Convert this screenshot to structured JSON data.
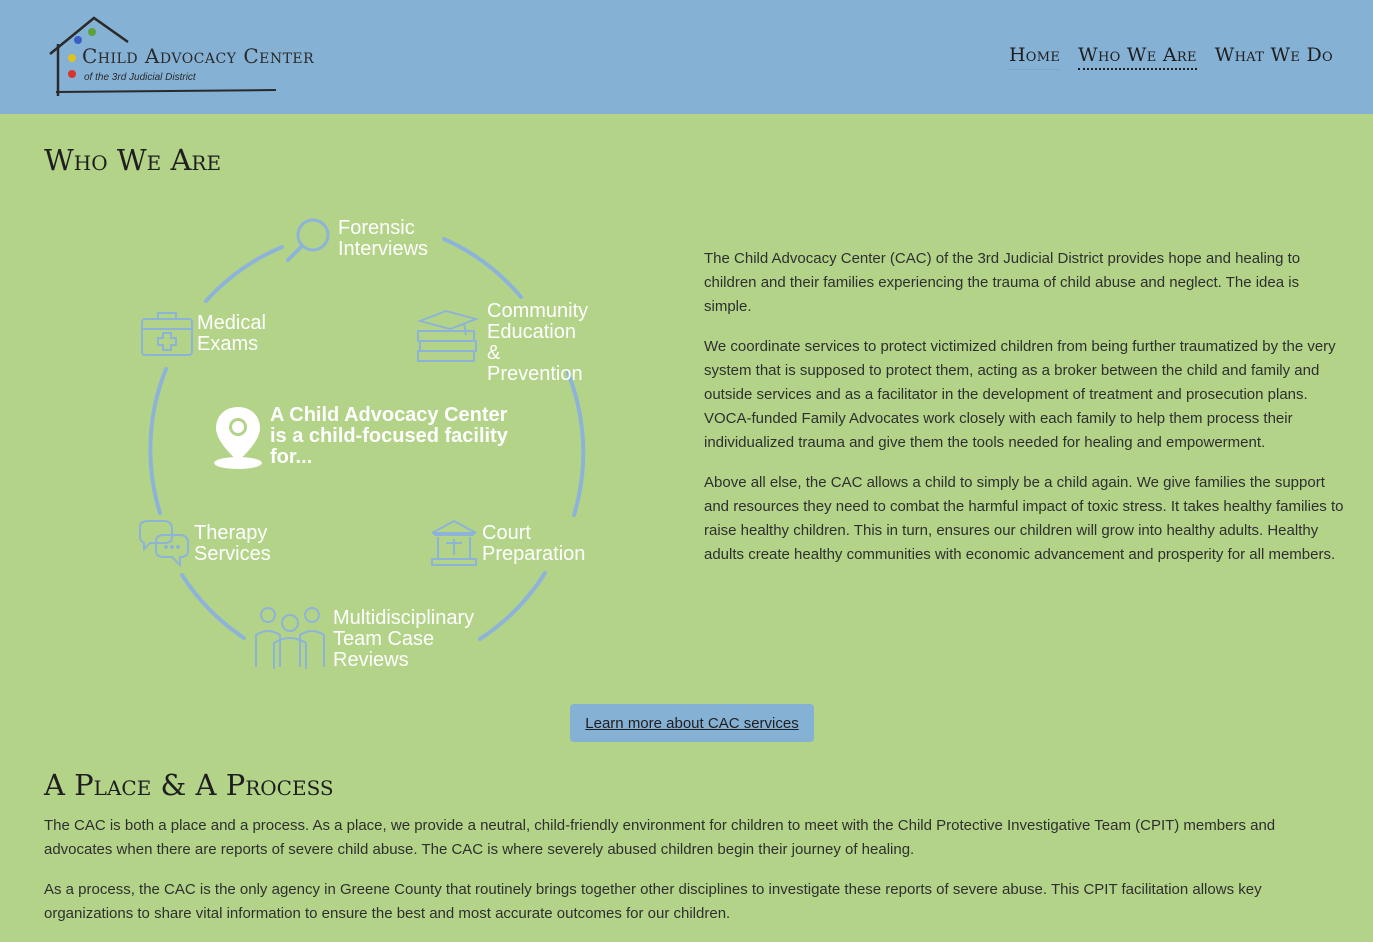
{
  "header": {
    "logo_title": "Child Advocacy Center",
    "logo_subtitle": "of the 3rd Judicial District",
    "nav": [
      {
        "label": "Home"
      },
      {
        "label": "Who We Are"
      },
      {
        "label": "What We Do"
      }
    ]
  },
  "section1": {
    "heading": "Who We Are",
    "diagram": {
      "center": "A Child Advocacy Center\nis a child-focused facility\nfor...",
      "items": [
        {
          "label": "Forensic\nInterviews",
          "icon": "magnifier-icon"
        },
        {
          "label": "Community\nEducation &\nPrevention",
          "icon": "books-icon"
        },
        {
          "label": "Court\nPreparation",
          "icon": "courthouse-icon"
        },
        {
          "label": "Multidisciplinary\nTeam Case\nReviews",
          "icon": "team-icon"
        },
        {
          "label": "Therapy\nServices",
          "icon": "chat-bubbles-icon"
        },
        {
          "label": "Medical\nExams",
          "icon": "medical-kit-icon"
        }
      ]
    },
    "paragraphs": [
      "The Child Advocacy Center (CAC) of the 3rd Judicial District provides hope and healing to children and their families experiencing the trauma of child abuse and neglect. The idea is simple.",
      "We coordinate services to protect victimized children from being further traumatized by the very system that is supposed to protect them, acting as a broker between the child and family and outside services and as a facilitator in the development of treatment and prosecution plans. VOCA-funded Family Advocates work closely with each family to help them process their individualized trauma and give them the tools needed for healing and empowerment.",
      "Above all else, the CAC allows a child to simply be a child again. We give families the support and resources they need to combat the harmful impact of toxic stress. It takes healthy families to raise healthy children. This in turn, ensures our children will grow into healthy adults. Healthy adults create healthy communities with economic advancement and prosperity for all members."
    ],
    "cta": "Learn more about CAC services"
  },
  "section2": {
    "heading": "A Place & A Process",
    "paragraphs": [
      "The CAC is both a place and a process. As a place, we provide a neutral, child-friendly environment for children to meet with the Child Protective Investigative Team (CPIT) members and advocates when there are reports of severe child abuse. The CAC is where severely abused children begin their journey of healing.",
      "As a process, the CAC is the only agency in Greene County that routinely brings together other disciplines to investigate these reports of severe abuse. This CPIT facilitation allows key organizations to share vital information to ensure the best and most accurate outcomes for our children."
    ]
  },
  "colors": {
    "header_bg": "#85b1d5",
    "page_bg": "#b3d389",
    "icon_blue": "#8db4d8"
  }
}
